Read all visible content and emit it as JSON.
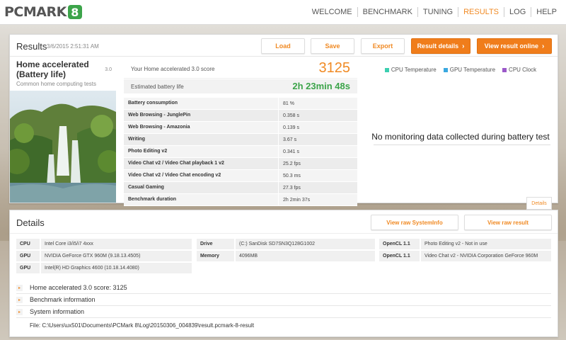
{
  "app": {
    "logo_text": "PCMARK",
    "logo_badge": "8"
  },
  "nav": {
    "items": [
      "WELCOME",
      "BENCHMARK",
      "TUNING",
      "RESULTS",
      "LOG",
      "HELP"
    ],
    "active": "RESULTS",
    "accent": "#f08a24"
  },
  "results": {
    "title": "Results",
    "date": "3/6/2015 2:51:31 AM",
    "buttons": {
      "load": "Load",
      "save": "Save",
      "export": "Export",
      "result_details": "Result details",
      "view_online": "View result online"
    },
    "test": {
      "name": "Home accelerated (Battery life)",
      "version": "3.0",
      "subtitle": "Common home computing tests"
    },
    "score_label": "Your Home accelerated 3.0 score",
    "score_value": "3125",
    "battery_label": "Estimated battery life",
    "battery_value": "2h 23min 48s",
    "subtests": [
      {
        "name": "Battery consumption",
        "value": "81 %"
      },
      {
        "name": "Web Browsing - JunglePin",
        "value": "0.358 s"
      },
      {
        "name": "Web Browsing - Amazonia",
        "value": "0.139 s"
      },
      {
        "name": "Writing",
        "value": "3.67 s"
      },
      {
        "name": "Photo Editing v2",
        "value": "0.341 s"
      },
      {
        "name": "Video Chat v2 / Video Chat playback 1 v2",
        "value": "25.2 fps"
      },
      {
        "name": "Video Chat v2 / Video Chat encoding v2",
        "value": "50.3 ms"
      },
      {
        "name": "Casual Gaming",
        "value": "27.3 fps"
      },
      {
        "name": "Benchmark duration",
        "value": "2h 2min 37s"
      }
    ],
    "monitor": {
      "legend": [
        {
          "label": "CPU Temperature",
          "color": "#3ccfb0"
        },
        {
          "label": "GPU Temperature",
          "color": "#3aa8e0"
        },
        {
          "label": "CPU Clock",
          "color": "#9b59c9"
        }
      ],
      "no_data": "No monitoring data collected during battery test",
      "details_button": "Details"
    }
  },
  "details": {
    "title": "Details",
    "buttons": {
      "systeminfo": "View raw SystemInfo",
      "raw_result": "View raw result"
    },
    "hw_col1": [
      {
        "k": "CPU",
        "v": "Intel Core i3/i5/i7 4xxx"
      },
      {
        "k": "GPU",
        "v": "NVIDIA GeForce GTX 960M (9.18.13.4505)"
      },
      {
        "k": "GPU",
        "v": "Intel(R) HD Graphics 4600 (10.18.14.4080)"
      }
    ],
    "hw_col2": [
      {
        "k": "Drive",
        "v": "(C:) SanDisk SD7SN3Q128G1002"
      },
      {
        "k": "Memory",
        "v": "4096MB"
      }
    ],
    "hw_col3": [
      {
        "k": "OpenCL 1.1",
        "v": "Photo Editing v2 - Not in use"
      },
      {
        "k": "OpenCL 1.1",
        "v": "Video Chat v2 - NVIDIA Corporation GeForce 960M"
      }
    ],
    "expanders": [
      "Home accelerated 3.0 score: 3125",
      "Benchmark information",
      "System information"
    ],
    "file": "File: C:\\Users\\ux501\\Documents\\PCMark 8\\Log\\20150306_004839\\result.pcmark-8-result"
  }
}
